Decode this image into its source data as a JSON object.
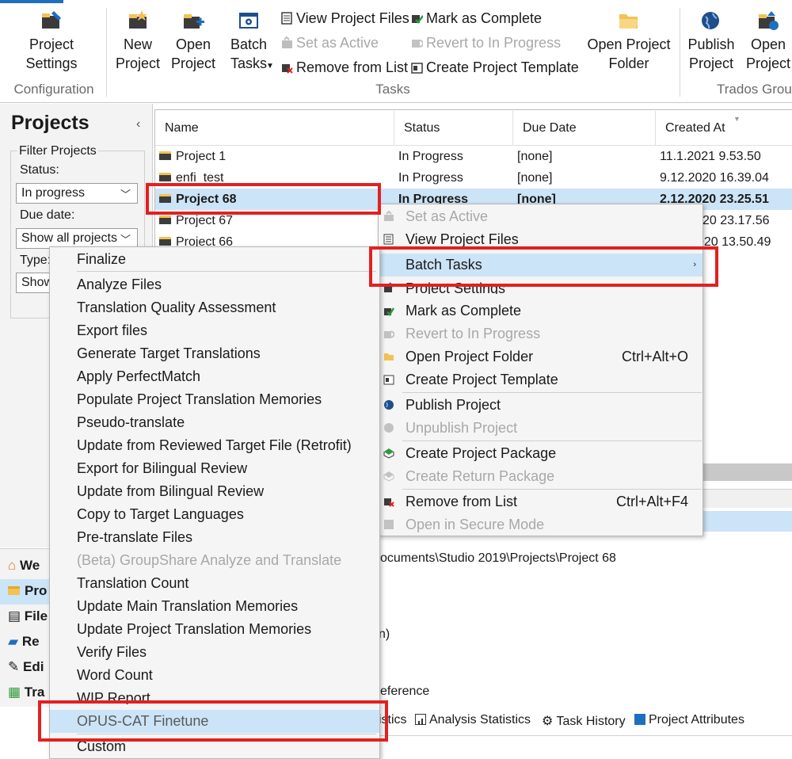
{
  "ribbon": {
    "configuration": {
      "project_settings": "Project\nSettings",
      "group_label": "Configuration"
    },
    "tasks": {
      "new_project": "New\nProject",
      "open_project": "Open\nProject",
      "batch_tasks": "Batch\nTasks",
      "view_project_files": "View Project Files",
      "set_as_active": "Set as Active",
      "remove_from_list": "Remove from List",
      "mark_as_complete": "Mark as Complete",
      "revert_to_in_progress": "Revert to In Progress",
      "create_project_template": "Create Project Template",
      "open_project_folder": "Open Project\nFolder",
      "group_label": "Tasks"
    },
    "trados_group": {
      "publish_project": "Publish\nProject",
      "open_project": "Open\nProject",
      "group_label": "Trados Grou"
    }
  },
  "left_panel": {
    "title": "Projects",
    "filter_title": "Filter Projects",
    "status_label": "Status:",
    "status_value": "In progress",
    "due_date_label": "Due date:",
    "due_date_value": "Show all projects",
    "type_label": "Type:",
    "type_value": "Show"
  },
  "grid": {
    "columns": [
      "Name",
      "Status",
      "Due Date",
      "Created At"
    ],
    "rows": [
      {
        "name": "Project 1",
        "status": "In Progress",
        "due": "[none]",
        "created": "11.1.2021 9.53.50"
      },
      {
        "name": "enfi_test",
        "status": "In Progress",
        "due": "[none]",
        "created": "9.12.2020 16.39.04"
      },
      {
        "name": "Project 68",
        "status": "In Progress",
        "due": "[none]",
        "created": "2.12.2020 23.25.51"
      },
      {
        "name": "Project 67",
        "status": "",
        "due": "",
        "created": "20 23.17.56"
      },
      {
        "name": "Project 66",
        "status": "",
        "due": "",
        "created": "020 13.50.49"
      }
    ]
  },
  "bottom": {
    "nav": [
      "We",
      "Pro",
      "File",
      "Re",
      "Edi",
      "Tra"
    ],
    "path": "ocuments\\Studio  2019\\Projects\\Project  68",
    "paren": "n)",
    "reference": "eference",
    "tabs": [
      "istics",
      "Analysis Statistics",
      "Task History",
      "Project Attributes"
    ]
  },
  "context_menu": {
    "items": [
      {
        "label": "Set as Active",
        "disabled": true,
        "icon": "set-active-icon"
      },
      {
        "label": "View Project Files",
        "disabled": false,
        "icon": "view-files-icon"
      },
      {
        "label": "Batch Tasks",
        "disabled": false,
        "icon": "",
        "submenu": true
      },
      {
        "label": "Project Settings",
        "disabled": false,
        "icon": "settings-icon"
      },
      {
        "label": "Mark as Complete",
        "disabled": false,
        "icon": "check-icon"
      },
      {
        "label": "Revert to In Progress",
        "disabled": true,
        "icon": "revert-icon"
      },
      {
        "label": "Open Project Folder",
        "disabled": false,
        "icon": "folder-icon",
        "shortcut": "Ctrl+Alt+O"
      },
      {
        "label": "Create Project Template",
        "disabled": false,
        "icon": "template-icon"
      },
      {
        "label": "Publish Project",
        "disabled": false,
        "icon": "publish-icon"
      },
      {
        "label": "Unpublish Project",
        "disabled": true,
        "icon": "unpublish-icon"
      },
      {
        "label": "Create Project Package",
        "disabled": false,
        "icon": "package-icon"
      },
      {
        "label": "Create Return Package",
        "disabled": true,
        "icon": "return-package-icon"
      },
      {
        "label": "Remove from List",
        "disabled": false,
        "icon": "remove-icon",
        "shortcut": "Ctrl+Alt+F4"
      },
      {
        "label": "Open in Secure Mode",
        "disabled": true,
        "icon": "secure-icon"
      }
    ]
  },
  "batch_submenu": {
    "items": [
      {
        "label": "Finalize",
        "disabled": false
      },
      {
        "label": "Analyze Files",
        "disabled": false
      },
      {
        "label": "Translation Quality Assessment",
        "disabled": false
      },
      {
        "label": "Export files",
        "disabled": false
      },
      {
        "label": "Generate Target Translations",
        "disabled": false
      },
      {
        "label": "Apply PerfectMatch",
        "disabled": false
      },
      {
        "label": "Populate Project Translation Memories",
        "disabled": false
      },
      {
        "label": "Pseudo-translate",
        "disabled": false
      },
      {
        "label": "Update from Reviewed Target File (Retrofit)",
        "disabled": false
      },
      {
        "label": "Export for Bilingual Review",
        "disabled": false
      },
      {
        "label": "Update from Bilingual Review",
        "disabled": false
      },
      {
        "label": "Copy to Target Languages",
        "disabled": false
      },
      {
        "label": "Pre-translate Files",
        "disabled": false
      },
      {
        "label": "(Beta) GroupShare Analyze and Translate",
        "disabled": true
      },
      {
        "label": "Translation Count",
        "disabled": false
      },
      {
        "label": "Update Main Translation Memories",
        "disabled": false
      },
      {
        "label": "Update Project Translation Memories",
        "disabled": false
      },
      {
        "label": "Verify Files",
        "disabled": false
      },
      {
        "label": "Word Count",
        "disabled": false
      },
      {
        "label": "WIP Report",
        "disabled": false
      },
      {
        "label": "OPUS-CAT Finetune",
        "disabled": false,
        "highlighted": true
      },
      {
        "label": "Custom",
        "disabled": false
      }
    ]
  },
  "colors": {
    "selection": "#cce4f7",
    "highlight_box": "#e32020",
    "accent": "#1e6fbf"
  }
}
